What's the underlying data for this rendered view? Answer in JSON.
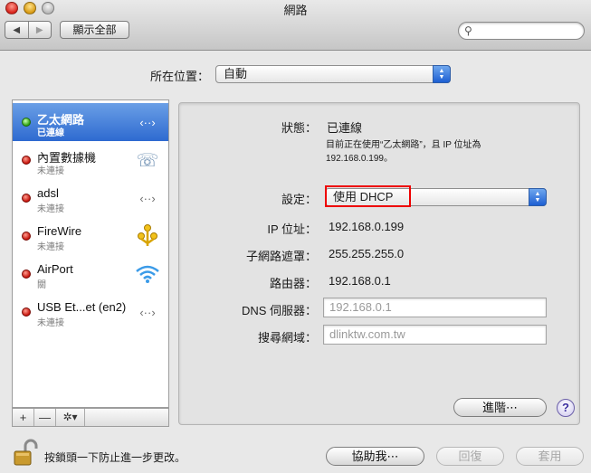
{
  "window": {
    "title": "網路"
  },
  "toolbar": {
    "back_label": "◀",
    "forward_label": "▶",
    "show_all_label": "顯示全部",
    "search_placeholder": ""
  },
  "location": {
    "label": "所在位置：",
    "value": "自動"
  },
  "services": [
    {
      "name": "乙太網路",
      "status": "已連線",
      "state": "connected",
      "icon": "ethernet-icon",
      "selected": true
    },
    {
      "name": "內置數據機",
      "status": "未連接",
      "state": "disconnected",
      "icon": "modem-phone-icon",
      "selected": false
    },
    {
      "name": "adsl",
      "status": "未連接",
      "state": "disconnected",
      "icon": "ethernet-icon",
      "selected": false
    },
    {
      "name": "FireWire",
      "status": "未連接",
      "state": "disconnected",
      "icon": "firewire-icon",
      "selected": false
    },
    {
      "name": "AirPort",
      "status": "關",
      "state": "off",
      "icon": "airport-wifi-icon",
      "selected": false
    },
    {
      "name": "USB Et...et (en2)",
      "status": "未連接",
      "state": "disconnected",
      "icon": "ethernet-icon",
      "selected": false
    }
  ],
  "sidebar_tools": {
    "add": "+",
    "remove": "—",
    "action": "✲▾"
  },
  "detail": {
    "status_label": "狀態：",
    "status_value": "已連線",
    "status_desc_line1": "目前正在使用“乙太網路”，且 IP 位址為",
    "status_desc_line2": "192.168.0.199。",
    "config_label": "設定：",
    "config_value": "使用 DHCP",
    "ip_label": "IP 位址：",
    "ip_value": "192.168.0.199",
    "subnet_label": "子網路遮罩：",
    "subnet_value": "255.255.255.0",
    "router_label": "路由器：",
    "router_value": "192.168.0.1",
    "dns_label": "DNS 伺服器：",
    "dns_value": "192.168.0.1",
    "search_domain_label": "搜尋網域：",
    "search_domain_value": "dlinktw.com.tw",
    "advanced_button": "進階⋯",
    "help_button": "?"
  },
  "footer": {
    "lock_message": "按鎖頭一下防止進一步更改。",
    "assist_button": "協助我⋯",
    "revert_button": "回復",
    "apply_button": "套用"
  },
  "colors": {
    "selection": "#3d78d8",
    "highlight_box": "#e00000",
    "connected": "#2ea20f",
    "disconnected": "#c5120a"
  }
}
